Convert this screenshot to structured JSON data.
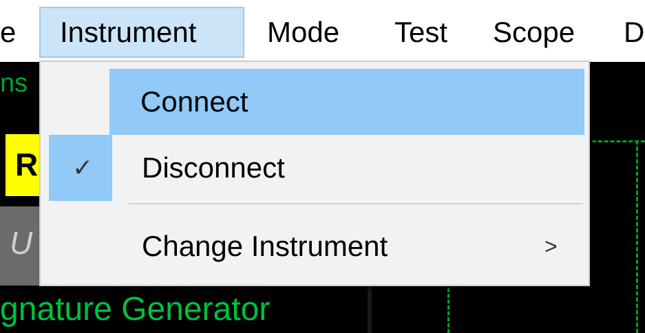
{
  "menubar": {
    "items": [
      {
        "label": "e"
      },
      {
        "label": "Instrument"
      },
      {
        "label": "Mode"
      },
      {
        "label": "Test"
      },
      {
        "label": "Scope"
      },
      {
        "label": "D"
      }
    ]
  },
  "background": {
    "tab_text": "ns",
    "yellow_text": "R",
    "grey_text": "U",
    "signature_text": "gnature Generator"
  },
  "dropdown": {
    "items": [
      {
        "label": "Connect",
        "highlighted": true
      },
      {
        "label": "Disconnect",
        "checked": true
      },
      {
        "label": "Change Instrument",
        "submenu_arrow": ">"
      }
    ]
  },
  "icons": {
    "check": "check-icon",
    "submenu": "chevron-right-icon"
  },
  "colors": {
    "highlight": "#91c9f7",
    "menu_active_bg": "#cce4f7",
    "scope_green": "#00a030",
    "signature_green": "#00c040",
    "yellow": "#ffff00"
  }
}
